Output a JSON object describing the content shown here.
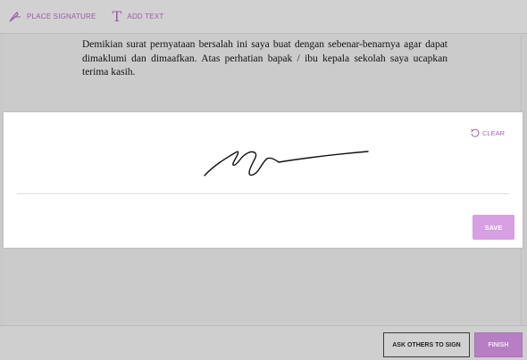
{
  "toolbar": {
    "place_signature_label": "PLACE SIGNATURE",
    "place_signature_icon": "pen-nib-icon",
    "add_text_label": "ADD TEXT",
    "add_text_icon": "text-t-icon"
  },
  "document": {
    "paragraph": "Demikian surat pernyataan bersalah ini saya buat dengan sebenar-benarnya agar dapat dimaklumi dan dimaafkan. Atas perhatian bapak / ibu kepala sekolah saya ucapkan terima kasih."
  },
  "signature_modal": {
    "clear_label": "CLEAR",
    "clear_icon": "undo-icon",
    "save_label": "SAVE"
  },
  "footer": {
    "ask_others_label": "ASK OTHERS TO SIGN",
    "finish_label": "FINISH"
  },
  "colors": {
    "accent": "#9a5aa8",
    "save_button": "#d6a0e2",
    "finish_button": "#b67fc4"
  }
}
